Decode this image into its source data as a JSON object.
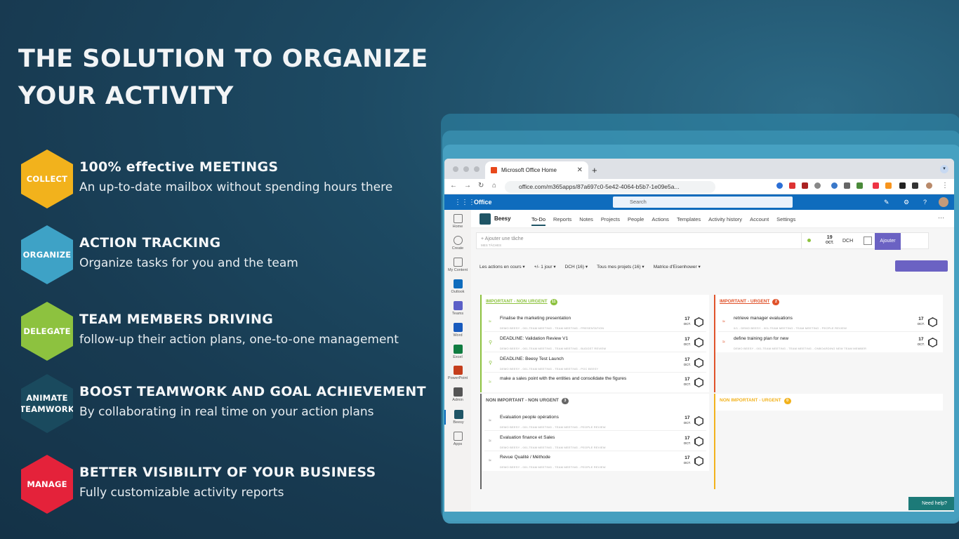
{
  "headline": {
    "line1": "THE SOLUTION TO ORGANIZE",
    "line2": "YOUR ACTIVITY"
  },
  "features": [
    {
      "hex_label": "COLLECT",
      "hex_color": "#f2b21c",
      "title": "100% effective MEETINGS",
      "desc": "An up-to-date mailbox without spending hours there"
    },
    {
      "hex_label": "ORGANIZE",
      "hex_color": "#3ea2c6",
      "title": "ACTION TRACKING",
      "desc": "Organize tasks for you and the team"
    },
    {
      "hex_label": "DELEGATE",
      "hex_color": "#8dc23f",
      "title": "TEAM MEMBERS DRIVING",
      "desc": "follow-up their action plans, one-to-one management"
    },
    {
      "hex_label_1": "ANIMATE",
      "hex_label_2": "TEAMWORK",
      "hex_color": "#1a4a5e",
      "title": "BOOST TEAMWORK AND GOAL ACHIEVEMENT",
      "desc": "By collaborating in real time on your action plans"
    },
    {
      "hex_label": "MANAGE",
      "hex_color": "#e4223a",
      "title": "BETTER VISIBILITY OF YOUR BUSINESS",
      "desc": "Fully customizable activity reports"
    }
  ],
  "browser": {
    "tab_title": "Microsoft Office Home",
    "url": "office.com/m365apps/87a697c0-5e42-4064-b5b7-1e09e5a...",
    "office_label": "Office",
    "search_placeholder": "Search"
  },
  "rail": [
    "Home",
    "Create",
    "My Content",
    "Outlook",
    "Teams",
    "Word",
    "Excel",
    "PowerPoint",
    "Admin",
    "Beesy",
    "Apps"
  ],
  "app": {
    "name": "Beesy",
    "nav": [
      "To-Do",
      "Reports",
      "Notes",
      "Projects",
      "People",
      "Actions",
      "Templates",
      "Activity history",
      "Account",
      "Settings"
    ],
    "add_placeholder": "+ Ajouter une tâche",
    "add_sub": "MES TÂCHES",
    "date_day": "19",
    "date_month": "OCT.",
    "owner": "DCH",
    "add_button": "Ajouter",
    "filters": [
      "Les actions en cours ▾",
      "+/- 1 jour ▾",
      "DCH (16) ▾",
      "Tous mes projets (16) ▾",
      "Matrice d'Eisenhower ▾"
    ],
    "help": "Need help?"
  },
  "quadrants": {
    "q1": {
      "title": "IMPORTANT - NON URGENT",
      "count": "11",
      "color": "#8dc23f",
      "tasks": [
        {
          "title": "Finalise the marketing presentation",
          "meta": "DEMO BEESY - 001-TEAM MEETING - TEAM MEETING - PRESENTATION",
          "day": "17",
          "month": "OCT."
        },
        {
          "title": "DEADLINE: Validation Review V1",
          "meta": "DEMO BEESY - 001-TEAM MEETING - TEAM MEETING - BUDGET REVIEW",
          "day": "17",
          "month": "OCT."
        },
        {
          "title": "DEADLINE: Beesy Test Launch",
          "meta": "DEMO BEESY - 001-TEAM MEETING - TEAM MEETING - POC BEESY",
          "day": "17",
          "month": "OCT."
        },
        {
          "title": "make a sales point with the entities and consolidate the figures",
          "meta": "",
          "day": "17",
          "month": "OCT."
        }
      ]
    },
    "q2": {
      "title": "IMPORTANT - URGENT",
      "count": "2",
      "color": "#e0522a",
      "tasks": [
        {
          "title": "retrieve manager evaluations",
          "meta": "0/1 - DEMO BEESY - 001-TEAM MEETING - TEAM MEETING - PEOPLE REVIEW",
          "day": "17",
          "month": "OCT."
        },
        {
          "title": "define training plan for new",
          "meta": "DEMO BEESY - 001-TEAM MEETING - TEAM MEETING - ONBOARDING NEW TEAM MEMBER",
          "day": "17",
          "month": "OCT."
        }
      ]
    },
    "q3": {
      "title": "NON IMPORTANT - NON URGENT",
      "count": "3",
      "color": "#666666",
      "tasks": [
        {
          "title": "Evaluation people opérations",
          "meta": "DEMO BEESY - 001-TEAM MEETING - TEAM MEETING - PEOPLE REVIEW",
          "day": "17",
          "month": "OCT."
        },
        {
          "title": "Evaluation finance et Sales",
          "meta": "DEMO BEESY - 001-TEAM MEETING - TEAM MEETING - PEOPLE REVIEW",
          "day": "17",
          "month": "OCT."
        },
        {
          "title": "Revue Qualité / Méthode",
          "meta": "DEMO BEESY - 001-TEAM MEETING - TEAM MEETING - PEOPLE REVIEW",
          "day": "17",
          "month": "OCT."
        }
      ]
    },
    "q4": {
      "title": "NON IMPORTANT - URGENT",
      "count": "0",
      "color": "#f2b21c",
      "tasks": []
    }
  }
}
